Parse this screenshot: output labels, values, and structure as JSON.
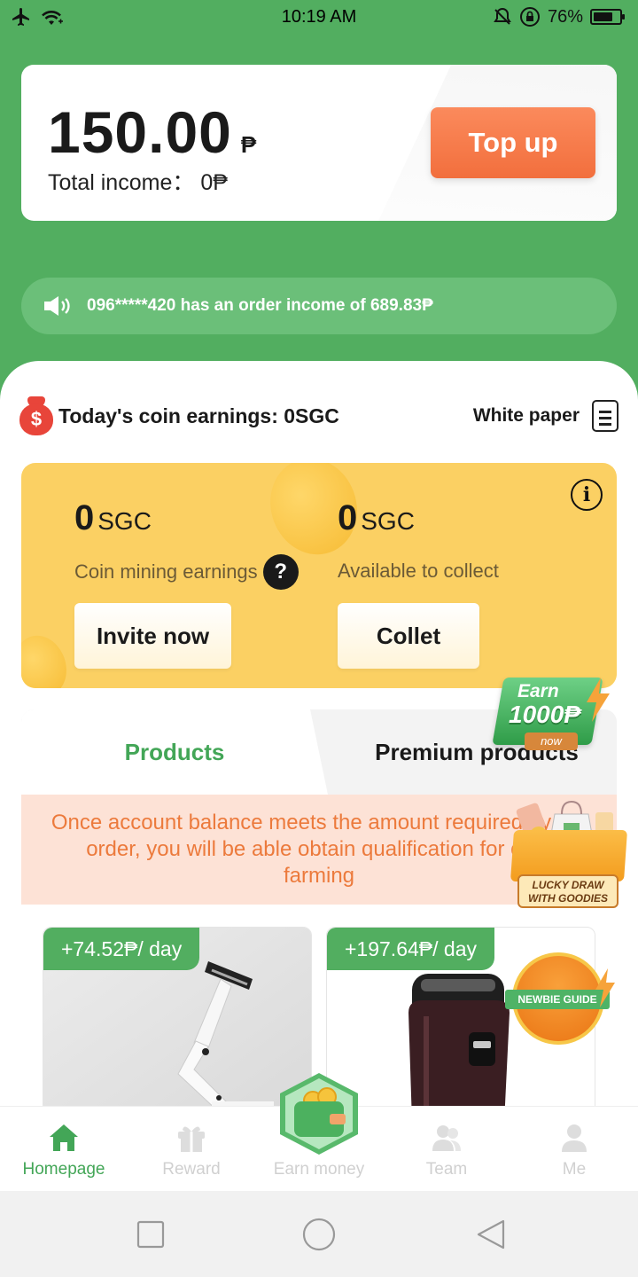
{
  "status_bar": {
    "time": "10:19 AM",
    "battery": "76%",
    "battery_level": 0.76
  },
  "balance": {
    "amount": "150.00",
    "currency": "₱",
    "income_label": "Total income：",
    "income_value": "0₱",
    "topup_label": "Top up"
  },
  "notice": {
    "text": "096*****420 has an order income of 689.83₱"
  },
  "coin": {
    "title": "Today's coin earnings: 0SGC",
    "white_paper": "White paper"
  },
  "mining": {
    "mining_value": "0",
    "mining_unit": "SGC",
    "mining_label": "Coin mining earnings",
    "collect_value": "0",
    "collect_unit": "SGC",
    "collect_label": "Available to collect",
    "invite_label": "Invite now",
    "collet_label": "Collet"
  },
  "tabs": {
    "products": "Products",
    "premium": "Premium products"
  },
  "banner": {
    "text": "Once account balance meets the amount required by the order, you will be able obtain qualification for click farming"
  },
  "products": [
    {
      "rate": "+74.52₱/ day",
      "image": "desk-lamp"
    },
    {
      "rate": "+197.64₱/ day",
      "image": "electric-shaver"
    }
  ],
  "badges": {
    "earn_top": "Earn",
    "earn_amount": "1000₱",
    "earn_now": "now",
    "lucky_line1": "LUCKY DRAW",
    "lucky_line2": "WITH GOODIES",
    "newbie": "NEWBIE GUIDE"
  },
  "tabbar": [
    {
      "label": "Homepage",
      "icon": "home-icon",
      "active": true
    },
    {
      "label": "Reward",
      "icon": "gift-icon",
      "active": false
    },
    {
      "label": "Earn money",
      "icon": "wallet-icon",
      "active": false
    },
    {
      "label": "Team",
      "icon": "team-icon",
      "active": false
    },
    {
      "label": "Me",
      "icon": "user-icon",
      "active": false
    }
  ],
  "colors": {
    "brand_green": "#52ae60",
    "topup_orange": "#f26f3d",
    "mining_yellow": "#fbd063",
    "banner_text": "#ec7a3c"
  }
}
